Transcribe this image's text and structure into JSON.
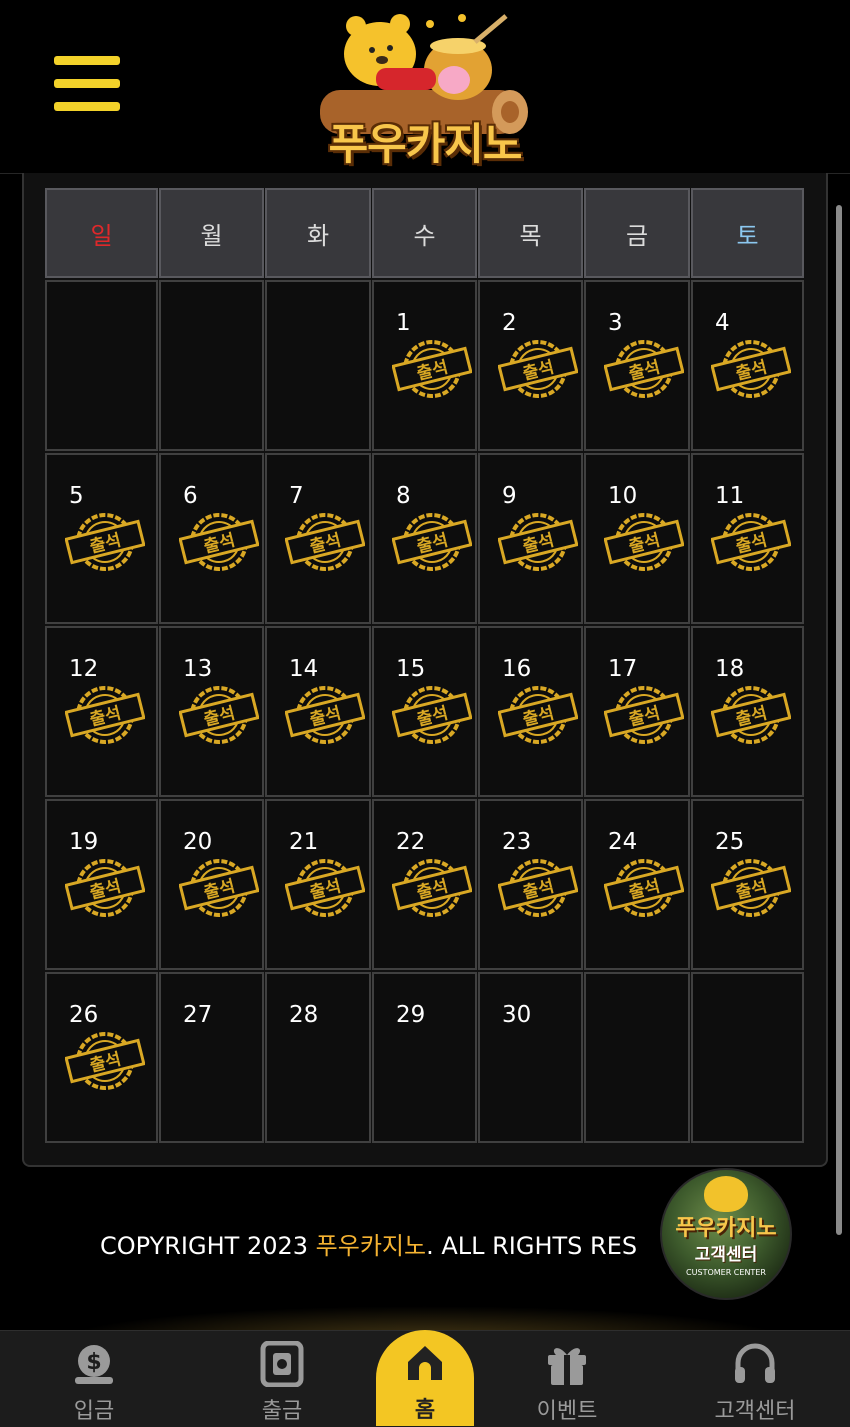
{
  "header": {
    "logo_text": "푸우카지노",
    "menu_icon": "hamburger-menu-icon"
  },
  "calendar": {
    "weekdays": [
      "일",
      "월",
      "화",
      "수",
      "목",
      "금",
      "토"
    ],
    "weekday_colors": [
      "#e0282a",
      "#dcdcdc",
      "#dcdcdc",
      "#dcdcdc",
      "#dcdcdc",
      "#dcdcdc",
      "#8cc8f0"
    ],
    "stamp_label": "출석",
    "stamp_color": "#d9a824",
    "weeks": [
      [
        {
          "day": ""
        },
        {
          "day": ""
        },
        {
          "day": ""
        },
        {
          "day": "1",
          "stamp": true
        },
        {
          "day": "2",
          "stamp": true
        },
        {
          "day": "3",
          "stamp": true
        },
        {
          "day": "4",
          "stamp": true
        }
      ],
      [
        {
          "day": "5",
          "stamp": true
        },
        {
          "day": "6",
          "stamp": true
        },
        {
          "day": "7",
          "stamp": true
        },
        {
          "day": "8",
          "stamp": true
        },
        {
          "day": "9",
          "stamp": true
        },
        {
          "day": "10",
          "stamp": true
        },
        {
          "day": "11",
          "stamp": true
        }
      ],
      [
        {
          "day": "12",
          "stamp": true
        },
        {
          "day": "13",
          "stamp": true
        },
        {
          "day": "14",
          "stamp": true
        },
        {
          "day": "15",
          "stamp": true
        },
        {
          "day": "16",
          "stamp": true
        },
        {
          "day": "17",
          "stamp": true
        },
        {
          "day": "18",
          "stamp": true
        }
      ],
      [
        {
          "day": "19",
          "stamp": true
        },
        {
          "day": "20",
          "stamp": true
        },
        {
          "day": "21",
          "stamp": true
        },
        {
          "day": "22",
          "stamp": true
        },
        {
          "day": "23",
          "stamp": true
        },
        {
          "day": "24",
          "stamp": true
        },
        {
          "day": "25",
          "stamp": true
        }
      ],
      [
        {
          "day": "26",
          "stamp": true
        },
        {
          "day": "27"
        },
        {
          "day": "28"
        },
        {
          "day": "29"
        },
        {
          "day": "30"
        },
        {
          "day": ""
        },
        {
          "day": ""
        }
      ]
    ]
  },
  "footer": {
    "copyright_prefix": "COPYRIGHT 2023 ",
    "copyright_brand": "푸우카지노",
    "copyright_suffix": ". ALL RIGHTS RES",
    "customer_center_badge": {
      "title": "푸우카지노",
      "subtitle": "고객센터",
      "caption": "CUSTOMER CENTER"
    }
  },
  "bottom_nav": {
    "items": [
      {
        "label": "입금",
        "icon": "dollar-coin-icon"
      },
      {
        "label": "출금",
        "icon": "withdraw-machine-icon"
      },
      {
        "label": "홈",
        "icon": "home-icon",
        "active": true
      },
      {
        "label": "이벤트",
        "icon": "gift-icon"
      },
      {
        "label": "고객센터",
        "icon": "headset-icon"
      }
    ],
    "active_color": "#f3c623"
  }
}
